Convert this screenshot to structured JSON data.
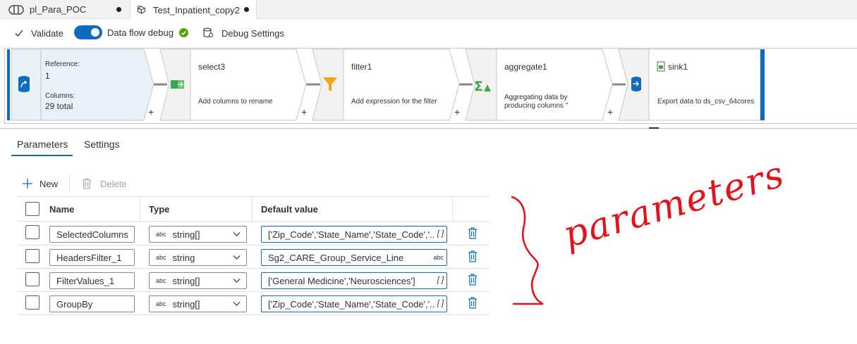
{
  "tabs": [
    {
      "label": "pl_Para_POC",
      "icon": "pipeline-icon",
      "unsaved": true
    },
    {
      "label": "Test_Inpatient_copy2",
      "icon": "dataflow-icon",
      "unsaved": true,
      "active": true
    }
  ],
  "toolbar": {
    "validate": "Validate",
    "debug_label": "Data flow debug",
    "debug_on": true,
    "debug_settings": "Debug Settings"
  },
  "flow": {
    "source": {
      "reference_label": "Reference:",
      "reference_value": "1",
      "columns_label": "Columns:",
      "columns_value": "29 total"
    },
    "nodes": [
      {
        "name": "select3",
        "desc": "Add columns to rename",
        "icon": "select-icon"
      },
      {
        "name": "filter1",
        "desc": "Add expression for the filter",
        "icon": "filter-icon"
      },
      {
        "name": "aggregate1",
        "desc_line1": "Aggregating data by",
        "desc_line2": "producing columns ''",
        "icon": "aggregate-icon"
      },
      {
        "name": "sink1",
        "desc": "Export data to ds_csv_64cores",
        "icon": "sink-icon"
      }
    ],
    "plus": "+"
  },
  "panel": {
    "tabs": [
      "Parameters",
      "Settings"
    ],
    "active_tab": "Parameters",
    "new_label": "New",
    "delete_label": "Delete",
    "columns": [
      "Name",
      "Type",
      "Default value"
    ],
    "type_prefix": "abc",
    "rows": [
      {
        "name": "SelectedColumns",
        "type": "string[]",
        "value": "['Zip_Code','State_Name','State_Code','...",
        "suffix": "[ ]"
      },
      {
        "name": "HeadersFilter_1",
        "type": "string",
        "value": "Sg2_CARE_Group_Service_Line",
        "suffix": "abc"
      },
      {
        "name": "FilterValues_1",
        "type": "string[]",
        "value": "['General Medicine','Neurosciences']",
        "suffix": "[ ]"
      },
      {
        "name": "GroupBy",
        "type": "string[]",
        "value": "['Zip_Code','State_Name','State_Code','...",
        "suffix": "[ ]"
      }
    ]
  },
  "annotation": {
    "handwritten_text": "parameters",
    "color": "#e3131b"
  },
  "colors": {
    "accent": "#0f6cbd",
    "success": "#57a300",
    "filter": "#f7a21b",
    "aggregate": "#3aa84d"
  }
}
